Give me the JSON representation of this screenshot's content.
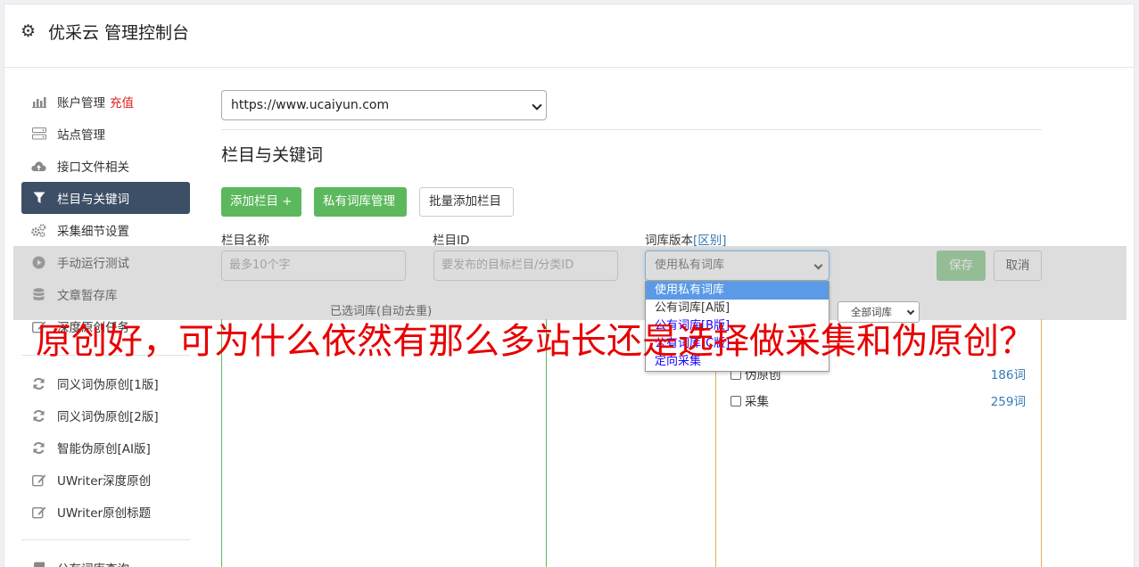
{
  "header": {
    "title": "优采云 管理控制台"
  },
  "sidebar": {
    "items": [
      {
        "label": "账户管理",
        "extra": "充值"
      },
      {
        "label": "站点管理"
      },
      {
        "label": "接口文件相关"
      },
      {
        "label": "栏目与关键词",
        "active": true
      },
      {
        "label": "采集细节设置"
      },
      {
        "label": "手动运行测试"
      },
      {
        "label": "文章暂存库"
      },
      {
        "label": "深度原创任务"
      }
    ],
    "items2": [
      {
        "label": "同义词伪原创[1版]"
      },
      {
        "label": "同义词伪原创[2版]"
      },
      {
        "label": "智能伪原创[AI版]"
      },
      {
        "label": "UWriter深度原创"
      },
      {
        "label": "UWriter原创标题"
      }
    ],
    "items3": [
      {
        "label": "公有词库查询"
      }
    ]
  },
  "main": {
    "site_select": "https://www.ucaiyun.com",
    "section_title": "栏目与关键词",
    "buttons": {
      "add_column": "添加栏目 +",
      "private_lib": "私有词库管理",
      "batch_add": "批量添加栏目"
    },
    "form": {
      "name_label": "栏目名称",
      "name_placeholder": "最多10个字",
      "id_label": "栏目ID",
      "id_placeholder": "要发布的目标栏目/分类ID",
      "version_label": "词库版本",
      "version_link": "[区别]",
      "version_value": "使用私有词库",
      "save": "保存",
      "cancel": "取消"
    },
    "selected_label": "已选词库(自动去重)",
    "lib_filter": "全部词库",
    "libraries": [
      {
        "name": "伪原创",
        "count": "186词"
      },
      {
        "name": "采集",
        "count": "259词"
      }
    ],
    "dropdown_options": [
      {
        "label": "使用私有词库",
        "selected": true
      },
      {
        "label": "公有词库[A版]"
      },
      {
        "label": "公有词库[B版]"
      },
      {
        "label": "公有词库[C版]"
      },
      {
        "label": "定向采集"
      }
    ]
  },
  "overlay": {
    "headline": "原创好，可为什么依然有那么多站长还是选择做采集和伪原创？"
  },
  "colors": {
    "active_nav": "#3d4f66",
    "green": "#5cb85c",
    "headline": "#e80000",
    "link": "#337ab7"
  }
}
